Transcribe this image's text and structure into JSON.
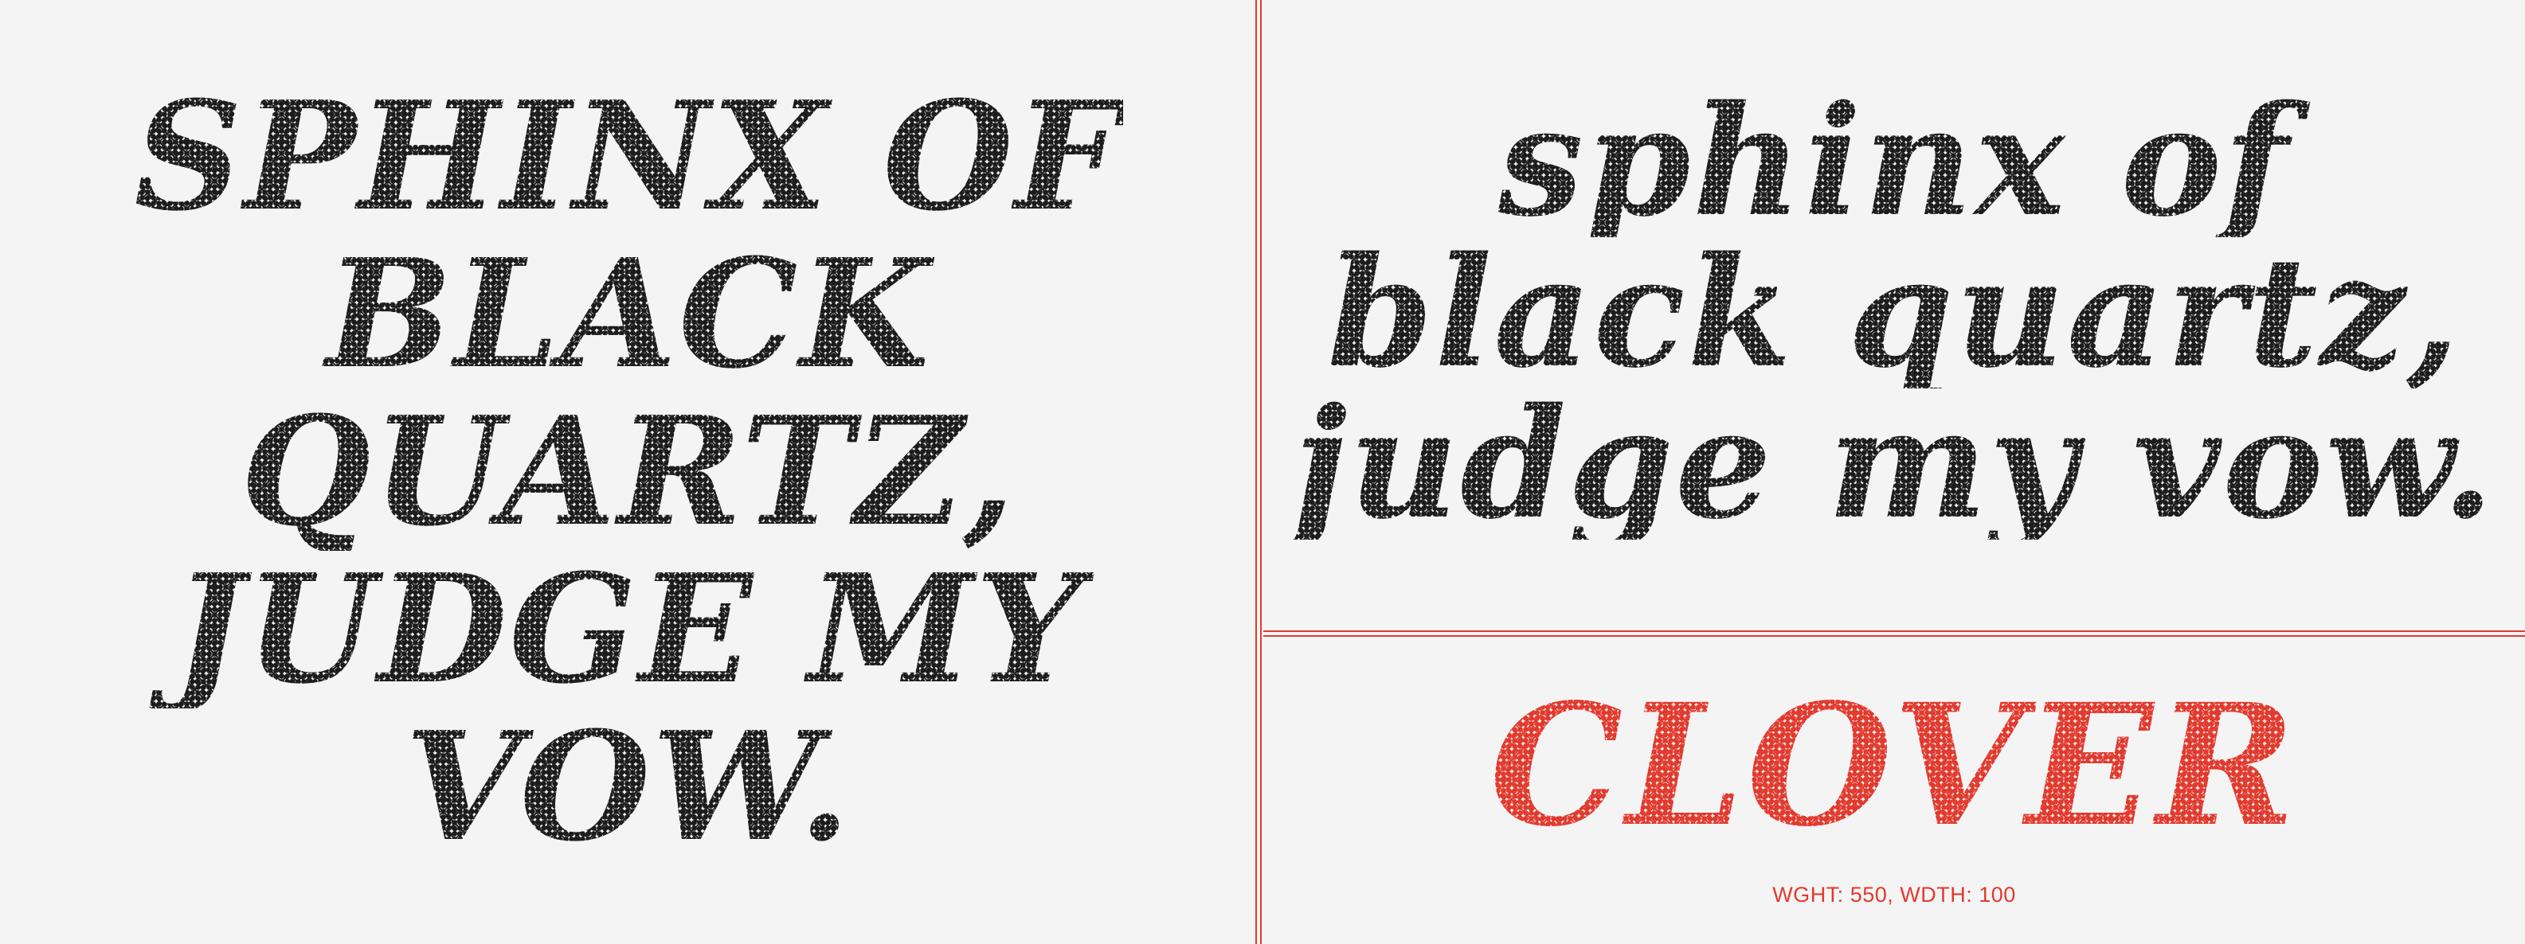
{
  "colors": {
    "background": "#f4f4f4",
    "ink": "#222222",
    "accent": "#e23a2e"
  },
  "specimen_upper": {
    "lines": [
      "SPHINX OF",
      "BLACK",
      "QUARTZ,",
      "JUDGE MY",
      "VOW."
    ]
  },
  "specimen_lower": {
    "lines": [
      "sphinx of",
      "black quartz,",
      "judge my vow."
    ]
  },
  "font_card": {
    "name": "CLOVER",
    "axes": "WGHT: 550, WDTH: 100"
  }
}
